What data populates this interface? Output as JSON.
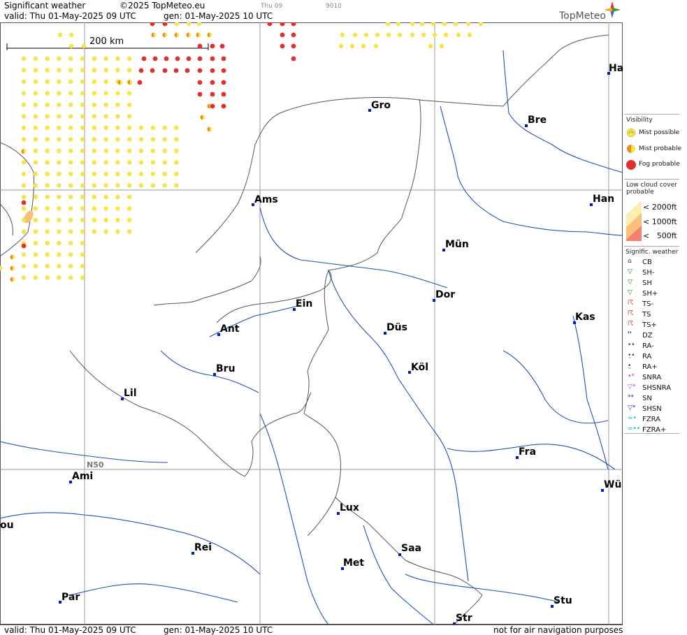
{
  "header": {
    "title": "Significant weather",
    "copyright": "©2025 TopMeteo.eu",
    "valid_line": "valid:  Thu   01-May-2025  09 UTC",
    "gen_line": "gen: 01-May-2025 10 UTC",
    "tab_time": "Thu 09",
    "tab_code": "9010"
  },
  "logo": {
    "text": "TopMeteo"
  },
  "scale": {
    "label": "200 km"
  },
  "grid": {
    "lat_label": "N50"
  },
  "cities": [
    {
      "name": "Gro"
    },
    {
      "name": "Bre"
    },
    {
      "name": "Ha"
    },
    {
      "name": "Ams"
    },
    {
      "name": "Han"
    },
    {
      "name": "Mün"
    },
    {
      "name": "Dor"
    },
    {
      "name": "Ein"
    },
    {
      "name": "Kas"
    },
    {
      "name": "Düs"
    },
    {
      "name": "Ant"
    },
    {
      "name": "Köl"
    },
    {
      "name": "Bru"
    },
    {
      "name": "Lil"
    },
    {
      "name": "Fra"
    },
    {
      "name": "Ami"
    },
    {
      "name": "Wü"
    },
    {
      "name": "Lux"
    },
    {
      "name": "ou"
    },
    {
      "name": "Rei"
    },
    {
      "name": "Saa"
    },
    {
      "name": "Met"
    },
    {
      "name": "Stu"
    },
    {
      "name": "Par"
    },
    {
      "name": "Str"
    }
  ],
  "legend": {
    "visibility": {
      "title": "Visibility",
      "items": [
        "Mist possible",
        "Mist probable",
        "Fog probable"
      ]
    },
    "low_cloud": {
      "title_line1": "Low cloud cover",
      "title_line2": "probable",
      "items": [
        "< 2000ft",
        "< 1000ft",
        "<   500ft"
      ]
    },
    "signif": {
      "title": "Signific. weather",
      "items": [
        "CB",
        "SH-",
        "SH",
        "SH+",
        "TS-",
        "TS",
        "TS+",
        "DZ",
        "RA-",
        "RA",
        "RA+",
        "SNRA",
        "SHSNRA",
        "SN",
        "SHSN",
        "FZRA",
        "FZRA+"
      ]
    }
  },
  "colors": {
    "mist_possible": "#f3e54a",
    "mist_probable": "#f08a1c",
    "fog_probable": "#e0302a",
    "river": "#1f4fb8",
    "border": "#555555",
    "city_marker": "#0018c8",
    "low_2000": "#fbeeb0",
    "low_1000": "#f9c07a",
    "low_500": "#f68070"
  },
  "footer": {
    "valid_line": "valid:  Thu   01-May-2025  09 UTC",
    "gen_line": "gen: 01-May-2025 10 UTC",
    "disclaimer": "not for air navigation purposes"
  }
}
